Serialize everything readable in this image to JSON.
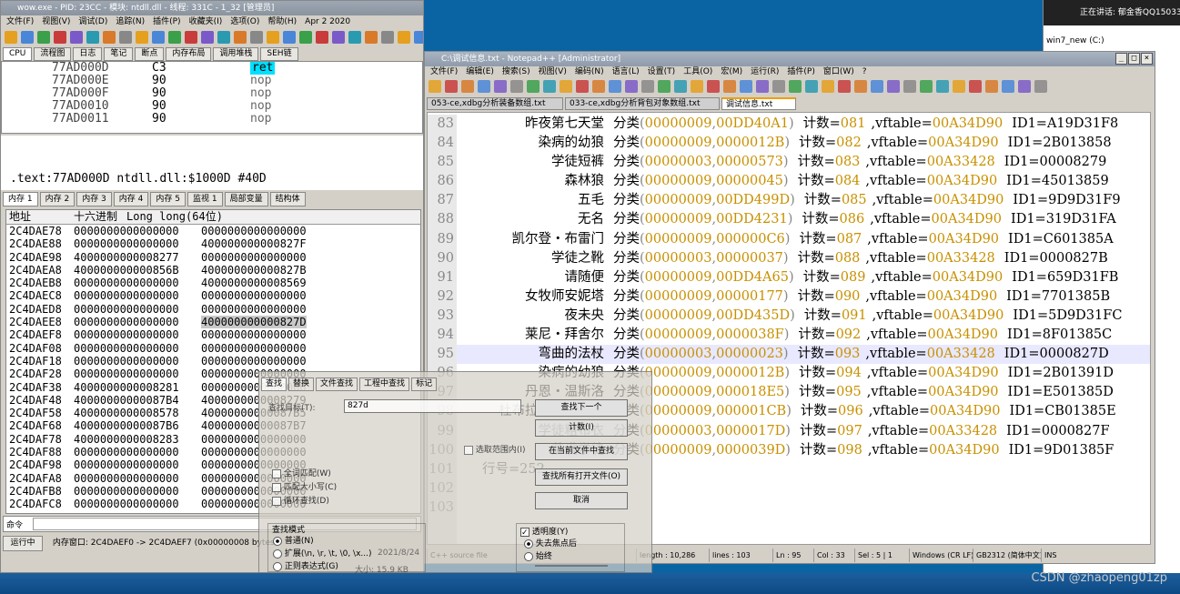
{
  "dbg": {
    "title": "wow.exe - PID: 23CC - 模块: ntdll.dll - 线程: 331C - 1_32 [管理员]",
    "menu": [
      "文件(F)",
      "视图(V)",
      "调试(D)",
      "追踪(N)",
      "插件(P)",
      "收藏夹(I)",
      "选项(O)",
      "帮助(H)",
      "Apr 2 2020"
    ],
    "tabs": [
      "CPU",
      "流程图",
      "日志",
      "笔记",
      "断点",
      "内存布局",
      "调用堆栈",
      "SEH链"
    ],
    "disasm": [
      [
        "77AD000D",
        "C3",
        "ret"
      ],
      [
        "77AD000E",
        "90",
        "nop"
      ],
      [
        "77AD000F",
        "90",
        "nop"
      ],
      [
        "77AD0010",
        "90",
        "nop"
      ],
      [
        "77AD0011",
        "90",
        "nop"
      ]
    ],
    "info": ".text:77AD000D ntdll.dll:$1000D #40D",
    "memtabs": [
      "内存 1",
      "内存 2",
      "内存 3",
      "内存 4",
      "内存 5",
      "监视 1",
      "局部变量",
      "结构体"
    ],
    "dump_headers": [
      "地址",
      "十六进制",
      "Long long(64位)"
    ],
    "dump": [
      [
        "2C4DAE78",
        "0000000000000000",
        "0000000000000000"
      ],
      [
        "2C4DAE88",
        "0000000000000000",
        "400000000000827F"
      ],
      [
        "2C4DAE98",
        "4000000000008277",
        "0000000000000000"
      ],
      [
        "2C4DAEA8",
        "400000000000856B",
        "400000000000827B"
      ],
      [
        "2C4DAEB8",
        "0000000000000000",
        "4000000000008569"
      ],
      [
        "2C4DAEC8",
        "0000000000000000",
        "0000000000000000"
      ],
      [
        "2C4DAED8",
        "0000000000000000",
        "0000000000000000"
      ],
      [
        "2C4DAEE8",
        "0000000000000000",
        "400000000000827D"
      ],
      [
        "2C4DAEF8",
        "0000000000000000",
        "0000000000000000"
      ],
      [
        "2C4DAF08",
        "0000000000000000",
        "0000000000000000"
      ],
      [
        "2C4DAF18",
        "0000000000000000",
        "0000000000000000"
      ],
      [
        "2C4DAF28",
        "0000000000000000",
        "0000000000000000"
      ],
      [
        "2C4DAF38",
        "4000000000008281",
        "0000000000000000"
      ],
      [
        "2C4DAF48",
        "40000000000087B4",
        "4000000000008279"
      ],
      [
        "2C4DAF58",
        "4000000000008578",
        "40000000000087B5"
      ],
      [
        "2C4DAF68",
        "40000000000087B6",
        "40000000000087B7"
      ],
      [
        "2C4DAF78",
        "4000000000008283",
        "0000000000000000"
      ],
      [
        "2C4DAF88",
        "0000000000000000",
        "0000000000000000"
      ],
      [
        "2C4DAF98",
        "0000000000000000",
        "0000000000000000"
      ],
      [
        "2C4DAFA8",
        "0000000000000000",
        "0000000000000000"
      ],
      [
        "2C4DAFB8",
        "0000000000000000",
        "0000000000000000"
      ],
      [
        "2C4DAFC8",
        "0000000000000000",
        "0000000000000000"
      ]
    ],
    "cmd_label": "命令",
    "status_left": "运行中",
    "status_text": "内存窗口: 2C4DAEF0 -> 2C4DAEF7 (0x00000008 bytes)"
  },
  "np": {
    "title": "C:\\调试信息.txt - Notepad++ [Administrator]",
    "menu": [
      "文件(F)",
      "编辑(E)",
      "搜索(S)",
      "视图(V)",
      "编码(N)",
      "语言(L)",
      "设置(T)",
      "工具(O)",
      "宏(M)",
      "运行(R)",
      "插件(P)",
      "窗口(W)",
      "?"
    ],
    "tabs": [
      "053-ce,xdbg分析装备数组.txt",
      "033-ce,xdbg分析背包对象数组.txt",
      "调试信息.txt"
    ],
    "lines": [
      {
        "n": "83",
        "name": "昨夜第七天堂",
        "a": "00000009",
        "b": "00DD40A1",
        "c": "081",
        "v": "00A34D90",
        "id": "A19D31F8"
      },
      {
        "n": "84",
        "name": "染病的幼狼",
        "a": "00000009",
        "b": "0000012B",
        "c": "082",
        "v": "00A34D90",
        "id": "2B013858"
      },
      {
        "n": "85",
        "name": "学徒短裤",
        "a": "00000003",
        "b": "00000573",
        "c": "083",
        "v": "00A33428",
        "id": "00008279"
      },
      {
        "n": "86",
        "name": "森林狼",
        "a": "00000009",
        "b": "00000045",
        "c": "084",
        "v": "00A34D90",
        "id": "45013859"
      },
      {
        "n": "87",
        "name": "五毛",
        "a": "00000009",
        "b": "00DD499D",
        "c": "085",
        "v": "00A34D90",
        "id": "9D9D31F9"
      },
      {
        "n": "88",
        "name": "无名",
        "a": "00000009",
        "b": "00DD4231",
        "c": "086",
        "v": "00A34D90",
        "id": "319D31FA"
      },
      {
        "n": "89",
        "name": "凯尔登・布雷门",
        "a": "00000009",
        "b": "000000C6",
        "c": "087",
        "v": "00A34D90",
        "id": "C601385A"
      },
      {
        "n": "90",
        "name": "学徒之靴",
        "a": "00000003",
        "b": "00000037",
        "c": "088",
        "v": "00A33428",
        "id": "0000827B"
      },
      {
        "n": "91",
        "name": "请随便",
        "a": "00000009",
        "b": "00DD4A65",
        "c": "089",
        "v": "00A34D90",
        "id": "659D31FB"
      },
      {
        "n": "92",
        "name": "女牧师安妮塔",
        "a": "00000009",
        "b": "00000177",
        "c": "090",
        "v": "00A34D90",
        "id": "7701385B"
      },
      {
        "n": "93",
        "name": "夜未央",
        "a": "00000009",
        "b": "00DD435D",
        "c": "091",
        "v": "00A34D90",
        "id": "5D9D31FC"
      },
      {
        "n": "94",
        "name": "莱尼・拜舍尔",
        "a": "00000009",
        "b": "0000038F",
        "c": "092",
        "v": "00A34D90",
        "id": "8F01385C"
      },
      {
        "n": "95",
        "name": "弯曲的法杖",
        "a": "00000003",
        "b": "00000023",
        "c": "093",
        "v": "00A33428",
        "id": "0000827D"
      },
      {
        "n": "96",
        "name": "染病的幼狼",
        "a": "00000009",
        "b": "0000012B",
        "c": "094",
        "v": "00A34D90",
        "id": "2B01391D"
      },
      {
        "n": "97",
        "name": "丹恩・温斯洛",
        "a": "00000009",
        "b": "000018E5",
        "c": "095",
        "v": "00A34D90",
        "id": "E501385D"
      },
      {
        "n": "98",
        "name": "杜布拉・托尔布雷",
        "a": "00000009",
        "b": "000001CB",
        "c": "096",
        "v": "00A34D90",
        "id": "CB01385E"
      },
      {
        "n": "99",
        "name": "学徒粗布衣",
        "a": "00000003",
        "b": "0000017D",
        "c": "097",
        "v": "00A33428",
        "id": "0000827F"
      },
      {
        "n": "100",
        "name": "萨满学徒",
        "a": "00000009",
        "b": "0000039D",
        "c": "098",
        "v": "00A34D90",
        "id": "9D01385F"
      }
    ],
    "line101": "行号=252",
    "line101n": "101",
    "line102n": "102",
    "line103n": "103",
    "kw_class": "分类",
    "kw_count": "计数=",
    "kw_vft": ",vftable=",
    "kw_id": "ID1=",
    "status": {
      "type": "C++ source file",
      "length": "length : 10,286",
      "lines": "lines : 103",
      "ln": "Ln : 95",
      "col": "Col : 33",
      "sel": "Sel : 5 | 1",
      "eol": "Windows (CR LF)",
      "enc": "GB2312 (简体中文)",
      "ins": "INS"
    }
  },
  "find": {
    "tabs": [
      "查找",
      "替换",
      "文件查找",
      "工程中查找",
      "标记"
    ],
    "label": "查找目标(T):",
    "value": "827d",
    "buttons": [
      "查找下一个",
      "计数(I)",
      "在当前文件中查找",
      "查找所有打开文件(O)",
      "取消"
    ],
    "options": [
      "选取范围内(I)",
      "全词匹配(W)",
      "匹配大小写(C)",
      "循环查找(D)"
    ],
    "mode_title": "查找模式",
    "modes": [
      "普通(N)",
      "扩展(\\n, \\r, \\t, \\0, \\x...)",
      "正则表达式(G)"
    ],
    "trans_label": "透明度(Y)",
    "trans_opts": [
      "失去焦点后",
      "始终"
    ],
    "bg_text": [
      "2021/8/24",
      "大小: 15.9 KB"
    ]
  },
  "right": {
    "speaking": "正在讲话: 郁金香QQ150330",
    "drive": "win7_new (C:)"
  },
  "watermark": "CSDN @zhaopeng01zp"
}
